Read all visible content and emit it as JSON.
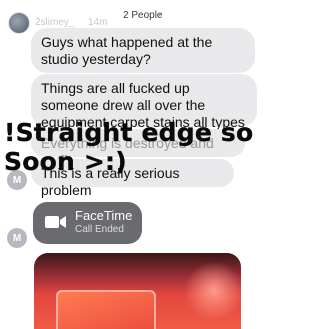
{
  "header": {
    "username": "2slimey_",
    "time": "14m",
    "conversation_title": "2 People",
    "chevron": "›"
  },
  "messages": [
    {
      "text": "Guys what happened at the studio yesterday?"
    },
    {
      "text": "Things are all fucked up someone drew all over the equipment carpet stains all types of shjt"
    },
    {
      "text": "Everything is destroyed and stuff"
    },
    {
      "text": "This is a really serious problem"
    }
  ],
  "sender_initial": "M",
  "facetime": {
    "title": "FaceTime",
    "subtitle": "Call Ended",
    "icon": "video-camera-icon"
  },
  "overlay": {
    "text": "!Straight edge so Soon >:)"
  },
  "colors": {
    "bubble_gray": "#e9e9eb",
    "facetime_bubble": "#6a6b6e",
    "overlay_text": "#0a0a0a"
  }
}
